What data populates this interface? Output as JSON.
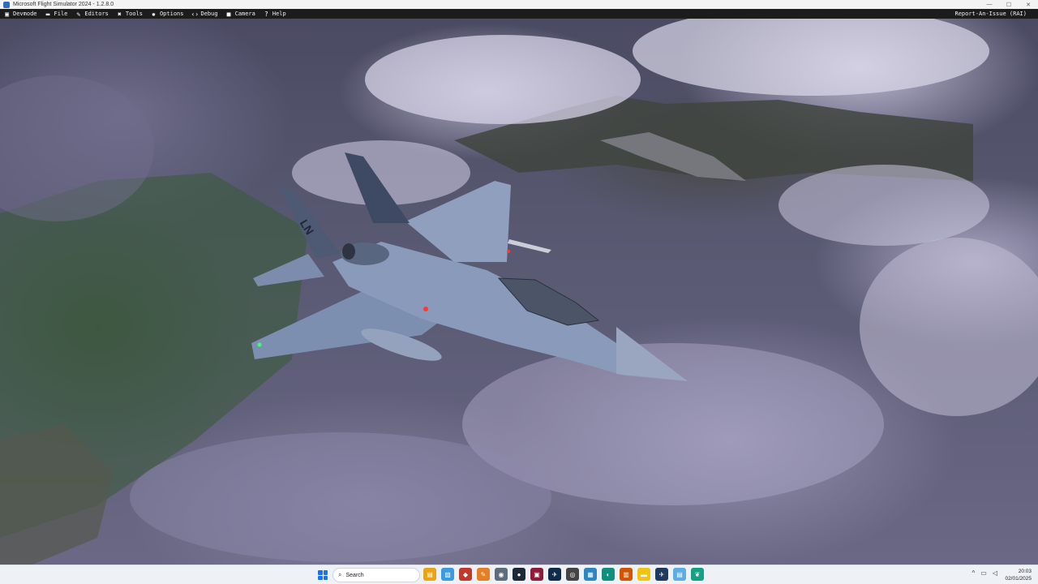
{
  "window": {
    "title": "Microsoft Flight Simulator 2024 - 1.2.8.0",
    "minimize_glyph": "—",
    "maximize_glyph": "☐",
    "close_glyph": "✕"
  },
  "menubar": {
    "items": [
      {
        "label": "Devmode",
        "icon": "devmode-icon",
        "glyph": "▣"
      },
      {
        "label": "File",
        "icon": "folder-icon",
        "glyph": "▬"
      },
      {
        "label": "Editors",
        "icon": "pencil-icon",
        "glyph": "✎"
      },
      {
        "label": "Tools",
        "icon": "tools-icon",
        "glyph": "✖"
      },
      {
        "label": "Options",
        "icon": "gear-icon",
        "glyph": "✹"
      },
      {
        "label": "Debug",
        "icon": "code-icon",
        "glyph": "‹›"
      },
      {
        "label": "Camera",
        "icon": "camera-icon",
        "glyph": "■"
      },
      {
        "label": "Help",
        "icon": "help-icon",
        "glyph": "?"
      }
    ],
    "report_issue": "Report-An-Issue (RAI)"
  },
  "taskbar": {
    "search_placeholder": "Search",
    "search_glyph": "⌕",
    "apps": [
      {
        "name": "file-explorer-icon",
        "color": "#e8a317",
        "glyph": "▤"
      },
      {
        "name": "photos-icon",
        "color": "#3c9be0",
        "glyph": "▨"
      },
      {
        "name": "app-red-icon",
        "color": "#c0392b",
        "glyph": "◆"
      },
      {
        "name": "paint-icon",
        "color": "#e67e22",
        "glyph": "✎"
      },
      {
        "name": "globe-icon",
        "color": "#5d6d7e",
        "glyph": "◉"
      },
      {
        "name": "steam-icon",
        "color": "#1b2838",
        "glyph": "●"
      },
      {
        "name": "app-maroon-icon",
        "color": "#8e1b3a",
        "glyph": "▣"
      },
      {
        "name": "msfs-icon",
        "color": "#102a4c",
        "glyph": "✈"
      },
      {
        "name": "xbox-controller-icon",
        "color": "#444444",
        "glyph": "◎"
      },
      {
        "name": "store-icon",
        "color": "#2e86c1",
        "glyph": "▦"
      },
      {
        "name": "edge-icon",
        "color": "#0f8f7e",
        "glyph": "◐"
      },
      {
        "name": "office-icon",
        "color": "#d35400",
        "glyph": "▥"
      },
      {
        "name": "folder-icon",
        "color": "#f1c40f",
        "glyph": "▬"
      },
      {
        "name": "flight-sim-icon",
        "color": "#1f3a5f",
        "glyph": "✈"
      },
      {
        "name": "notepad-icon",
        "color": "#5dade2",
        "glyph": "▤"
      },
      {
        "name": "feather-icon",
        "color": "#16a085",
        "glyph": "❦"
      }
    ],
    "tray": [
      {
        "name": "chevron-up-icon",
        "glyph": "^"
      },
      {
        "name": "network-icon",
        "glyph": "▭"
      },
      {
        "name": "volume-icon",
        "glyph": "◁"
      }
    ],
    "time": "20:03",
    "date": "02/01/2025"
  },
  "aircraft": {
    "tail_code": "LN"
  }
}
